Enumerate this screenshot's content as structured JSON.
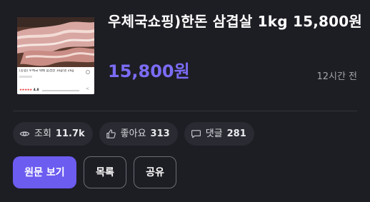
{
  "product": {
    "title": "우체국쇼핑)한돈 삼겹살 1kg 15,800원",
    "price": "15,800원",
    "time_ago": "12시간 전"
  },
  "thumbnail": {
    "title_text": "[농협] 우체국 택배 삼겹살 1kg(냉 2kg",
    "rating": "4.8"
  },
  "stats": {
    "views_label": "조회",
    "views_value": "11.7k",
    "likes_label": "좋아요",
    "likes_value": "313",
    "comments_label": "댓글",
    "comments_value": "281"
  },
  "actions": {
    "view_original_label": "원문 보기",
    "list_label": "목록",
    "share_label": "공유"
  },
  "colors": {
    "accent": "#6c5cf0",
    "price": "#7b6cf5",
    "background": "#1d1d24",
    "chip": "#2a2a32"
  },
  "icons": {
    "views": "eye-icon",
    "likes": "thumbs-up-icon",
    "comments": "comment-bubble-icon"
  }
}
